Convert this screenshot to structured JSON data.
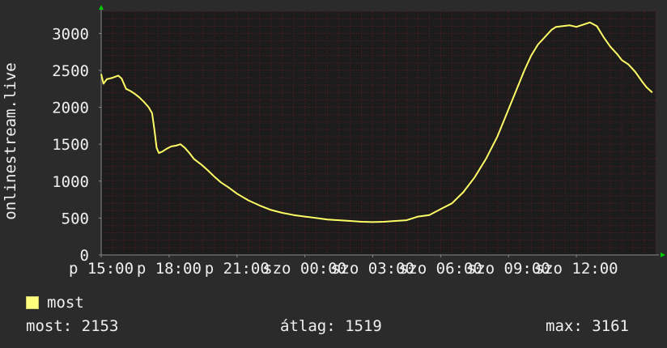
{
  "colors": {
    "background": "#2b2b2b",
    "plot": "#1c1c1c",
    "grid": "#5a1e1e",
    "line": "#ffff66",
    "axis": "#888888",
    "arrow": "#00cc00"
  },
  "chart_data": {
    "type": "line",
    "ylabel": "onlinestream.live",
    "ylim": [
      0,
      3300
    ],
    "yticks": [
      0,
      500,
      1000,
      1500,
      2000,
      2500,
      3000
    ],
    "xlim": [
      0,
      24.5
    ],
    "xticks": [
      {
        "x": 0,
        "label": "p 15:00"
      },
      {
        "x": 3,
        "label": "p 18:00"
      },
      {
        "x": 6,
        "label": "p 21:00"
      },
      {
        "x": 9,
        "label": "szo 00:00"
      },
      {
        "x": 12,
        "label": "szo 03:00"
      },
      {
        "x": 15,
        "label": "szo 06:00"
      },
      {
        "x": 18,
        "label": "szo 09:00"
      },
      {
        "x": 21,
        "label": "szo 12:00"
      }
    ],
    "series": [
      {
        "name": "most",
        "x": [
          0,
          0.1,
          0.25,
          0.5,
          0.75,
          0.9,
          1.1,
          1.3,
          1.5,
          1.7,
          1.9,
          2.1,
          2.25,
          2.35,
          2.45,
          2.55,
          2.7,
          2.9,
          3.1,
          3.3,
          3.5,
          3.7,
          3.9,
          4.1,
          4.4,
          4.7,
          5.0,
          5.3,
          5.6,
          6.0,
          6.5,
          7.0,
          7.5,
          8.0,
          8.5,
          9.0,
          9.5,
          10.0,
          10.5,
          11.0,
          11.5,
          12.0,
          12.5,
          13.0,
          13.5,
          14.0,
          14.5,
          15.0,
          15.5,
          16.0,
          16.5,
          17.0,
          17.5,
          17.9,
          18.3,
          18.7,
          19.0,
          19.3,
          19.6,
          19.9,
          20.1,
          20.4,
          20.7,
          21.0,
          21.3,
          21.6,
          21.9,
          22.2,
          22.5,
          22.8,
          23.0,
          23.3,
          23.6,
          23.9,
          24.1,
          24.35
        ],
        "values": [
          2450,
          2320,
          2380,
          2400,
          2430,
          2390,
          2250,
          2220,
          2180,
          2130,
          2070,
          2000,
          1920,
          1700,
          1450,
          1380,
          1400,
          1440,
          1470,
          1480,
          1500,
          1450,
          1380,
          1300,
          1230,
          1150,
          1060,
          980,
          920,
          830,
          740,
          670,
          610,
          570,
          540,
          520,
          500,
          480,
          470,
          460,
          450,
          445,
          450,
          460,
          470,
          520,
          540,
          620,
          700,
          850,
          1050,
          1300,
          1600,
          1900,
          2200,
          2500,
          2700,
          2850,
          2950,
          3050,
          3090,
          3100,
          3110,
          3090,
          3120,
          3150,
          3100,
          2950,
          2820,
          2720,
          2640,
          2580,
          2480,
          2350,
          2270,
          2200
        ]
      }
    ]
  },
  "legend": {
    "label": "most"
  },
  "stats": {
    "most": "most: 2153",
    "avg": "átlag: 1519",
    "max": "max: 3161"
  }
}
